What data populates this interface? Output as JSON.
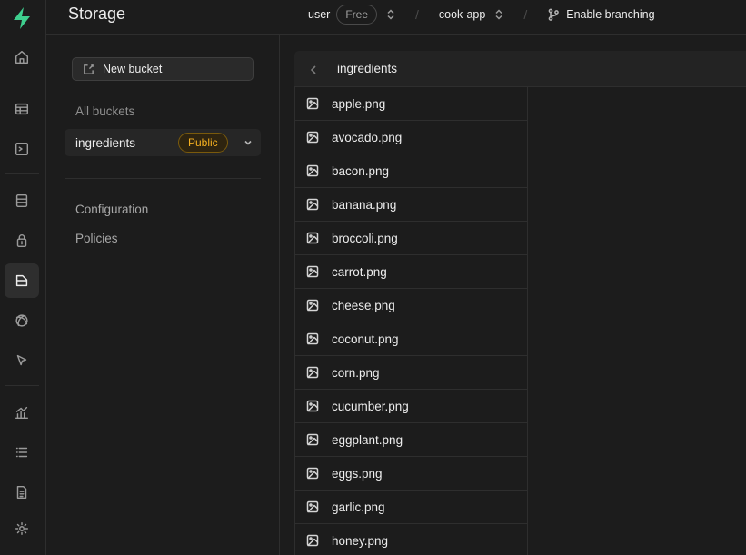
{
  "header": {
    "section_title": "Storage",
    "org": "user",
    "plan": "Free",
    "project": "cook-app",
    "branching_label": "Enable branching"
  },
  "rail": {
    "items": [
      "home-icon",
      "table-editor-icon",
      "sql-editor-icon",
      "database-icon",
      "auth-icon",
      "storage-icon",
      "realtime-icon",
      "edge-functions-icon",
      "reports-icon",
      "logs-icon",
      "api-docs-icon",
      "settings-icon"
    ],
    "active": "storage-icon",
    "brand_color": "#3ecf8e"
  },
  "sidebar": {
    "new_bucket_label": "New bucket",
    "all_buckets_label": "All buckets",
    "bucket": {
      "name": "ingredients",
      "badge": "Public"
    },
    "config_label": "Configuration",
    "policies_label": "Policies"
  },
  "explorer": {
    "current_bucket": "ingredients",
    "files": [
      "apple.png",
      "avocado.png",
      "bacon.png",
      "banana.png",
      "broccoli.png",
      "carrot.png",
      "cheese.png",
      "coconut.png",
      "corn.png",
      "cucumber.png",
      "eggplant.png",
      "eggs.png",
      "garlic.png",
      "honey.png"
    ]
  }
}
